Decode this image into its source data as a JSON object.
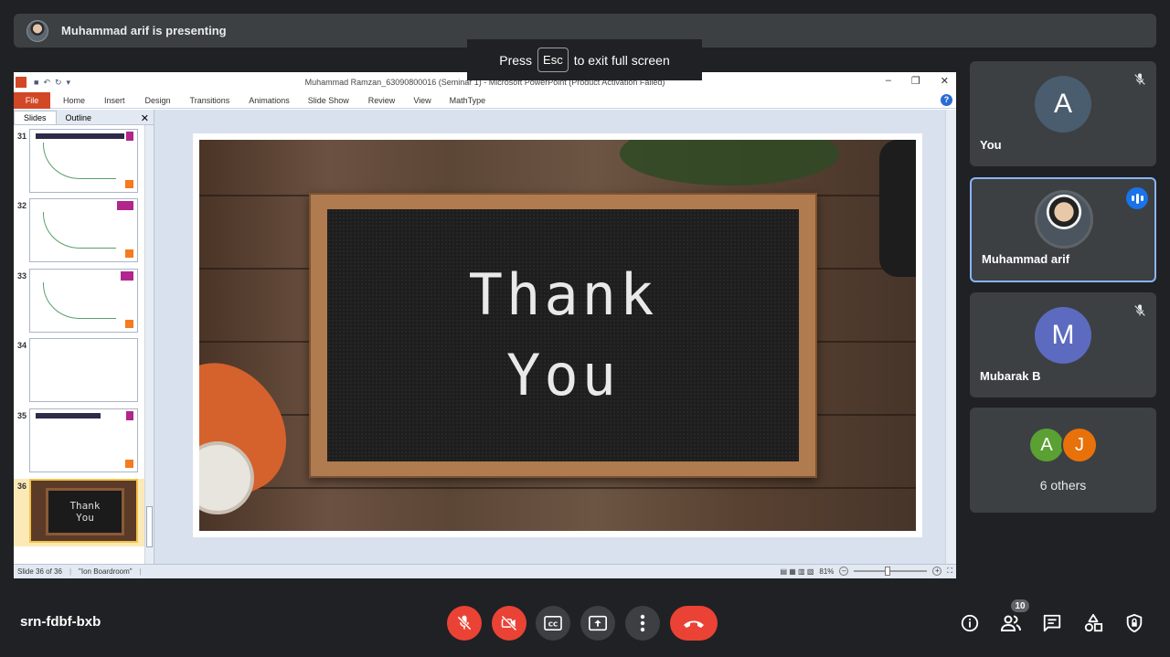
{
  "banner": {
    "text": "Muhammad arif is presenting"
  },
  "fullscreen_tip": {
    "prefix": "Press",
    "key": "Esc",
    "suffix": "to exit full screen"
  },
  "powerpoint": {
    "title": "Muhammad Ramzan_63090800016 (Seminar 1)  -  Microsoft PowerPoint (Product Activation Failed)",
    "ribbon_tabs": [
      "File",
      "Home",
      "Insert",
      "Design",
      "Transitions",
      "Animations",
      "Slide Show",
      "Review",
      "View",
      "MathType"
    ],
    "pane_tabs": [
      "Slides",
      "Outline"
    ],
    "slide_numbers": [
      "31",
      "32",
      "33",
      "34",
      "35",
      "36"
    ],
    "selected_thumb_text": [
      "Thank",
      "You"
    ],
    "slide_text": [
      "Thank",
      "You"
    ],
    "status": {
      "slide": "Slide 36 of 36",
      "theme": "\"Ion Boardroom\"",
      "zoom": "81%"
    }
  },
  "participants": [
    {
      "initial": "A",
      "name": "You",
      "color": "#4a5d6e",
      "muted": true
    },
    {
      "name": "Muhammad arif",
      "speaking": true
    },
    {
      "initial": "M",
      "name": "Mubarak B",
      "color": "#5c6bc0",
      "muted": true
    }
  ],
  "others": {
    "avatars": [
      {
        "initial": "A",
        "color": "#5ba033"
      },
      {
        "initial": "J",
        "color": "#e8710a"
      }
    ],
    "label": "6 others"
  },
  "toolbar": {
    "meeting_code": "srn-fdbf-bxb",
    "people_count": "10"
  }
}
